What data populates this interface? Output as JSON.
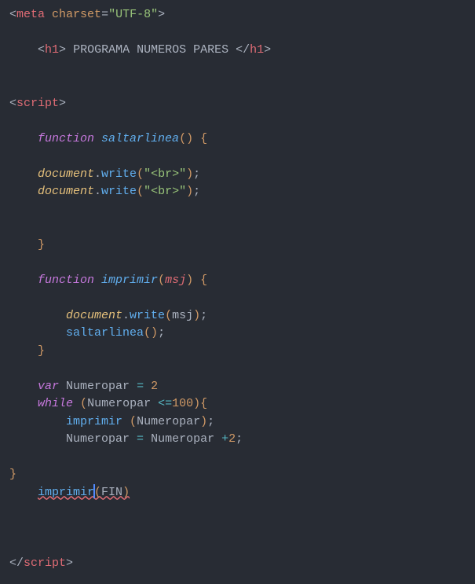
{
  "code": {
    "meta_tag": "meta",
    "meta_attr": "charset",
    "meta_val": "\"UTF-8\"",
    "h1_open": "h1",
    "h1_text": " PROGRAMA NUMEROS PARES ",
    "h1_close": "h1",
    "script_open": "script",
    "kw_function1": "function",
    "fn_saltarlinea": "saltarlinea",
    "obj_document": "document",
    "fn_write": "write",
    "str_br": "\"<br>\"",
    "kw_function2": "function",
    "fn_imprimir": "imprimir",
    "param_msj": "msj",
    "call_saltarlinea": "saltarlinea",
    "kw_var": "var",
    "var_numeropar": "Numeropar",
    "num_2": "2",
    "kw_while": "while",
    "num_100": "100",
    "call_imprimir1": "imprimir",
    "call_imprimir2": "imprimir",
    "id_fin": "FIN",
    "script_close": "script",
    "op_eq": "=",
    "op_lte": "<=",
    "op_plus": "+"
  }
}
